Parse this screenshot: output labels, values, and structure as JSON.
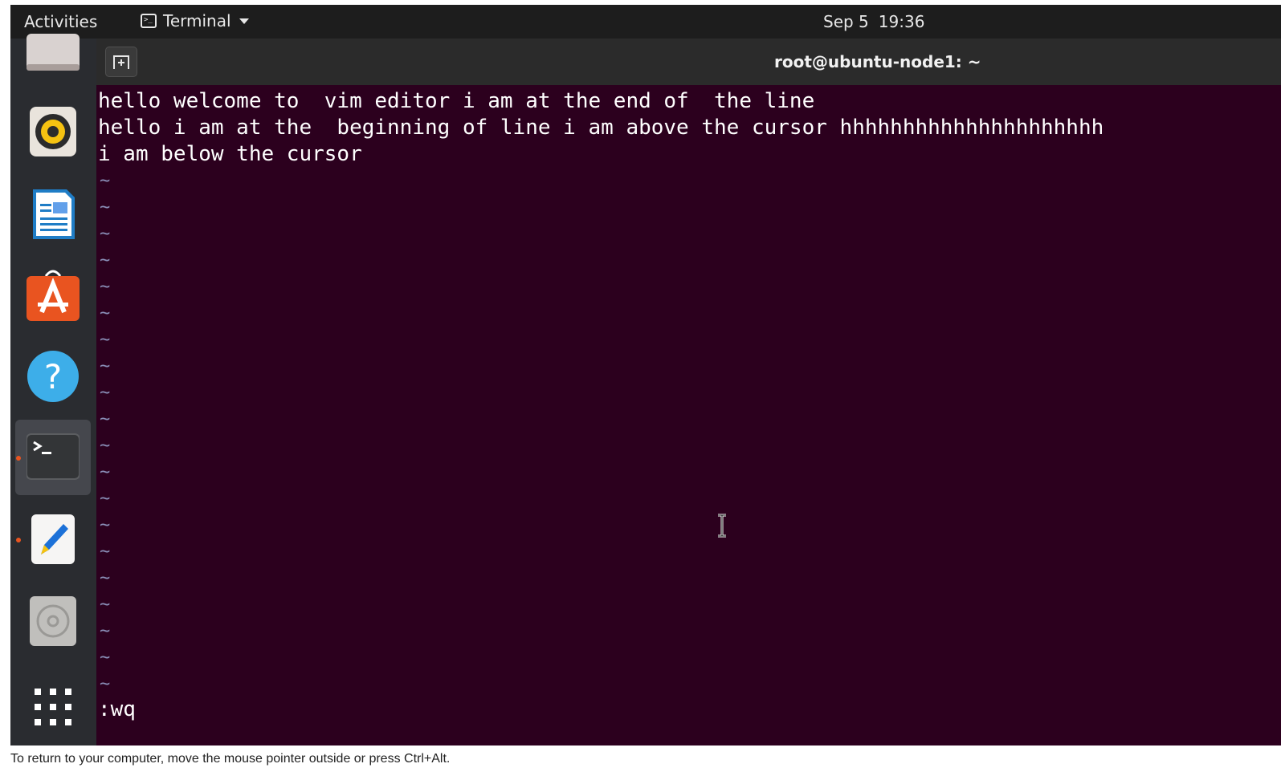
{
  "topbar": {
    "activities_label": "Activities",
    "app_menu_label": "Terminal",
    "date": "Sep 5",
    "time": "19:36"
  },
  "dock": {
    "items": [
      {
        "name": "files-icon"
      },
      {
        "name": "rhythmbox-icon"
      },
      {
        "name": "libreoffice-writer-icon"
      },
      {
        "name": "ubuntu-software-icon"
      },
      {
        "name": "help-icon"
      },
      {
        "name": "terminal-icon",
        "running": true,
        "active": true
      },
      {
        "name": "text-editor-icon",
        "running": true
      },
      {
        "name": "optical-drive-icon"
      },
      {
        "name": "show-applications-icon"
      }
    ],
    "running_dot_color": "#e95420"
  },
  "window": {
    "title": "root@ubuntu-node1: ~",
    "background": "#2c001e"
  },
  "terminal": {
    "lines": [
      "hello welcome to  vim editor i am at the end of  the line",
      "hello i am at the  beginning of line i am above the cursor hhhhhhhhhhhhhhhhhhhhh",
      "i am below the cursor"
    ],
    "tilde_char": "~",
    "tilde_count": 20,
    "command_line": ":wq"
  },
  "statusbar": {
    "text": "To return to your computer, move the mouse pointer outside or press Ctrl+Alt."
  }
}
